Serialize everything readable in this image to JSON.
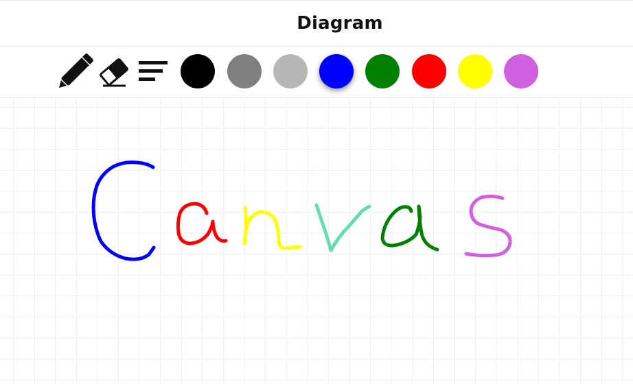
{
  "header": {
    "title": "Diagram"
  },
  "toolbar": {
    "tools": [
      {
        "name": "pencil",
        "icon": "pencil-icon"
      },
      {
        "name": "eraser",
        "icon": "eraser-icon"
      },
      {
        "name": "stroke-width",
        "icon": "lines-icon"
      }
    ],
    "colors": [
      {
        "name": "black",
        "hex": "#000000"
      },
      {
        "name": "dark-gray",
        "hex": "#808080"
      },
      {
        "name": "light-gray",
        "hex": "#b7b7b7"
      },
      {
        "name": "blue",
        "hex": "#0000ff"
      },
      {
        "name": "green",
        "hex": "#008000"
      },
      {
        "name": "red",
        "hex": "#ff0000"
      },
      {
        "name": "yellow",
        "hex": "#ffff00"
      },
      {
        "name": "violet",
        "hex": "#d060e0"
      }
    ],
    "selected_color": "blue"
  },
  "canvas": {
    "handwritten_strokes": [
      {
        "letter": "C",
        "color": "#0000ff"
      },
      {
        "letter": "a",
        "color": "#ff0000"
      },
      {
        "letter": "n",
        "color": "#ffff00"
      },
      {
        "letter": "v",
        "color": "#66dcb4"
      },
      {
        "letter": "a",
        "color": "#008000"
      },
      {
        "letter": "s",
        "color": "#d060e0"
      }
    ]
  }
}
